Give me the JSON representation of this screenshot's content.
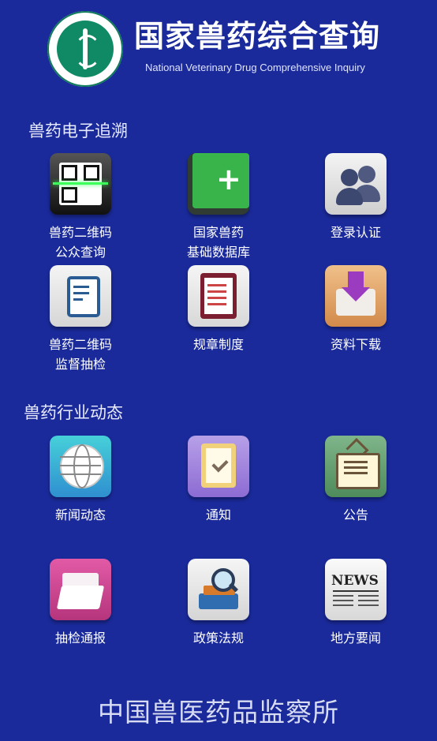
{
  "header": {
    "title": "国家兽药综合查询",
    "subtitle": "National Veterinary Drug Comprehensive Inquiry",
    "logo_icon": "china-institute-veterinary-drug-control-logo"
  },
  "sections": [
    {
      "title": "兽药电子追溯",
      "items": [
        {
          "label": [
            "兽药二维码",
            "公众查询"
          ],
          "icon": "qr-code-scan-icon"
        },
        {
          "label": [
            "国家兽药",
            "基础数据库"
          ],
          "icon": "book-plus-icon"
        },
        {
          "label": [
            "登录认证"
          ],
          "icon": "users-icon"
        },
        {
          "label": [
            "兽药二维码",
            "监督抽检"
          ],
          "icon": "document-check-icon"
        },
        {
          "label": [
            "规章制度"
          ],
          "icon": "clipboard-checklist-icon"
        },
        {
          "label": [
            "资料下载"
          ],
          "icon": "download-tray-icon"
        }
      ]
    },
    {
      "title": "兽药行业动态",
      "items": [
        {
          "label": [
            "新闻动态"
          ],
          "icon": "globe-icon"
        },
        {
          "label": [
            "通知"
          ],
          "icon": "notepad-check-icon"
        },
        {
          "label": [
            "公告"
          ],
          "icon": "notice-board-icon"
        },
        {
          "label": [
            "抽检通报"
          ],
          "icon": "folder-icon"
        },
        {
          "label": [
            "政策法规"
          ],
          "icon": "books-magnifier-icon"
        },
        {
          "label": [
            "地方要闻"
          ],
          "icon": "newspaper-icon"
        }
      ]
    }
  ],
  "footer": {
    "text": "中国兽医药品监察所"
  },
  "news_icon_text": "NEWS",
  "colors": {
    "background": "#1a2a9a",
    "text": "#ffffff"
  }
}
